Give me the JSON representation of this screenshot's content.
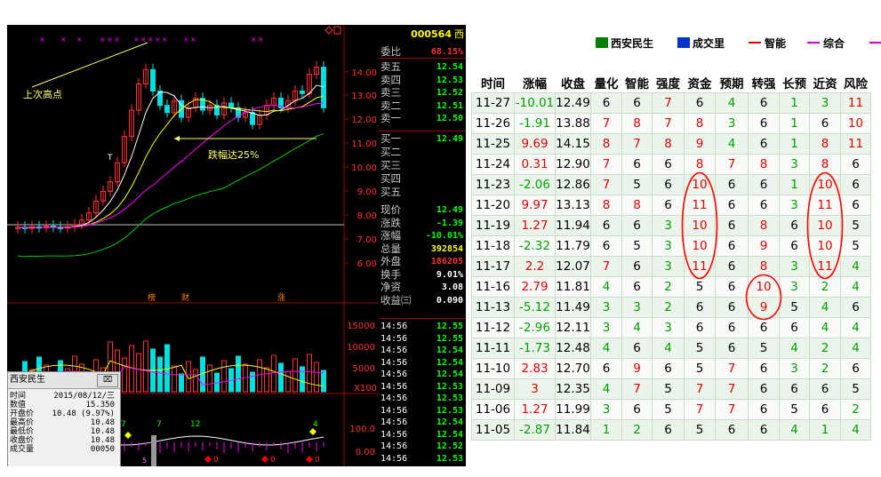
{
  "stock_code": "000564",
  "stock_suffix": "西",
  "weibi": {
    "label": "委比",
    "value": "68.15%"
  },
  "sell_levels": [
    {
      "label": "卖五",
      "price": "12.54"
    },
    {
      "label": "卖四",
      "price": "12.53"
    },
    {
      "label": "卖三",
      "price": "12.52"
    },
    {
      "label": "卖二",
      "price": "12.51"
    },
    {
      "label": "卖一",
      "price": "12.50"
    }
  ],
  "buy_levels": [
    {
      "label": "买一",
      "price": "12.49"
    },
    {
      "label": "买二",
      "price": ""
    },
    {
      "label": "买三",
      "price": ""
    },
    {
      "label": "买四",
      "price": ""
    },
    {
      "label": "买五",
      "price": ""
    }
  ],
  "quote_stats": [
    {
      "label": "现价",
      "value": "12.49",
      "color": "#00ff00"
    },
    {
      "label": "涨跌",
      "value": "-1.39",
      "color": "#00ff00"
    },
    {
      "label": "涨幅",
      "value": "-10.01%",
      "color": "#00ff00"
    },
    {
      "label": "总量",
      "value": "392854",
      "color": "#ffff00"
    },
    {
      "label": "外盘",
      "value": "186205",
      "color": "#ff3030"
    },
    {
      "label": "换手",
      "value": "9.01%",
      "color": "#ffffff"
    },
    {
      "label": "净资",
      "value": "3.08",
      "color": "#ffffff"
    },
    {
      "label": "收益㈢",
      "value": "0.090",
      "color": "#ffffff"
    }
  ],
  "ticks": [
    {
      "time": "14:56",
      "price": "12.55"
    },
    {
      "time": "14:56",
      "price": "12.55"
    },
    {
      "time": "14:56",
      "price": "12.54"
    },
    {
      "time": "14:56",
      "price": "12.54"
    },
    {
      "time": "14:56",
      "price": "12.54"
    },
    {
      "time": "14:56",
      "price": "12.53"
    },
    {
      "time": "14:56",
      "price": "12.53"
    },
    {
      "time": "14:56",
      "price": "12.53"
    },
    {
      "time": "14:56",
      "price": "12.54"
    },
    {
      "time": "14:56",
      "price": "12.54"
    },
    {
      "time": "14:56",
      "price": "12.52"
    },
    {
      "time": "14:56",
      "price": "12.53"
    }
  ],
  "price_axis": [
    "14.00",
    "13.00",
    "12.00",
    "11.00",
    "10.00",
    "9.00",
    "8.00",
    "7.00",
    "6.00"
  ],
  "volume_axis": [
    "15000",
    "10000",
    "5000",
    "X100"
  ],
  "indicator_axis": [
    "100.0",
    "0.00"
  ],
  "annotations": {
    "prev_high": "上次高点",
    "drop": "跌幅达25%",
    "marker_bang": "榜",
    "marker_cai": "财",
    "marker_zhang": "涨",
    "ind_7a": "7",
    "ind_7b": "7",
    "ind_12": "12",
    "ind_4": "4",
    "ind_0a": "0",
    "ind_0b": "0",
    "ind_0c": "0",
    "ind_small": "5",
    "candle_t": "T"
  },
  "popup": {
    "title": "西安民生",
    "close": "⌧",
    "rows": [
      {
        "label": "时间",
        "value": "2015/08/12/三"
      },
      {
        "label": "数值",
        "value": "15.350"
      },
      {
        "label": "开盘价",
        "value": "10.48 (9.97%)"
      },
      {
        "label": "最高价",
        "value": "10.48"
      },
      {
        "label": "最低价",
        "value": "10.48"
      },
      {
        "label": "收盘价",
        "value": "10.48"
      },
      {
        "label": "成交量",
        "value": "00050"
      }
    ]
  },
  "legend": [
    {
      "label": "西安民生",
      "color": "#008000",
      "kind": "box"
    },
    {
      "label": "成交里",
      "color": "#0033cc",
      "kind": "box"
    },
    {
      "label": "智能",
      "color": "#e00000",
      "kind": "line"
    },
    {
      "label": "综合",
      "color": "#cc00cc",
      "kind": "line"
    }
  ],
  "table": {
    "headers": [
      "时间",
      "涨幅",
      "收盘",
      "量化",
      "智能",
      "强度",
      "资金",
      "预期",
      "转强",
      "长预",
      "近资",
      "风险"
    ],
    "rows": [
      [
        "11-27",
        "-10.01",
        "12.49",
        "6",
        "6",
        "7",
        "6",
        "4",
        "6",
        "1",
        "3",
        "11"
      ],
      [
        "11-26",
        "-1.91",
        "13.88",
        "7",
        "8",
        "7",
        "8",
        "3",
        "6",
        "1",
        "6",
        "10"
      ],
      [
        "11-25",
        "9.69",
        "14.15",
        "8",
        "7",
        "8",
        "9",
        "4",
        "6",
        "1",
        "8",
        "11"
      ],
      [
        "11-24",
        "0.31",
        "12.90",
        "7",
        "6",
        "6",
        "8",
        "7",
        "8",
        "3",
        "8",
        "6"
      ],
      [
        "11-23",
        "-2.06",
        "12.86",
        "7",
        "5",
        "6",
        "10",
        "6",
        "6",
        "1",
        "10",
        "6"
      ],
      [
        "11-20",
        "9.97",
        "13.13",
        "8",
        "8",
        "6",
        "11",
        "6",
        "6",
        "3",
        "11",
        "6"
      ],
      [
        "11-19",
        "1.27",
        "11.94",
        "6",
        "6",
        "3",
        "10",
        "6",
        "8",
        "6",
        "10",
        "5"
      ],
      [
        "11-18",
        "-2.32",
        "11.79",
        "6",
        "5",
        "3",
        "10",
        "6",
        "9",
        "6",
        "10",
        "5"
      ],
      [
        "11-17",
        "2.2",
        "12.07",
        "7",
        "6",
        "3",
        "11",
        "6",
        "8",
        "3",
        "11",
        "4"
      ],
      [
        "11-16",
        "2.79",
        "11.81",
        "4",
        "6",
        "2",
        "5",
        "6",
        "10",
        "3",
        "2",
        "4"
      ],
      [
        "11-13",
        "-5.12",
        "11.49",
        "3",
        "3",
        "2",
        "6",
        "6",
        "9",
        "5",
        "4",
        "6"
      ],
      [
        "11-12",
        "-2.96",
        "12.11",
        "3",
        "4",
        "3",
        "6",
        "6",
        "6",
        "6",
        "4",
        "4"
      ],
      [
        "11-11",
        "-1.73",
        "12.48",
        "4",
        "6",
        "4",
        "5",
        "6",
        "5",
        "4",
        "2",
        "4"
      ],
      [
        "11-10",
        "2.83",
        "12.70",
        "6",
        "9",
        "6",
        "5",
        "7",
        "6",
        "3",
        "2",
        "6"
      ],
      [
        "11-09",
        "3",
        "12.35",
        "4",
        "7",
        "5",
        "7",
        "7",
        "6",
        "6",
        "6",
        "5"
      ],
      [
        "11-06",
        "1.27",
        "11.99",
        "3",
        "6",
        "5",
        "7",
        "7",
        "6",
        "5",
        "6",
        "2"
      ],
      [
        "11-05",
        "-2.87",
        "11.84",
        "1",
        "2",
        "6",
        "5",
        "6",
        "6",
        "4",
        "1",
        "4"
      ]
    ]
  },
  "colors": {
    "up": "#ff3030",
    "down": "#00e0e0",
    "ma5": "#ffffff",
    "ma10": "#ffff00",
    "ma20": "#ff00ff",
    "ma60": "#00cc00",
    "table_red": "#e00000",
    "table_green": "#00a000"
  }
}
